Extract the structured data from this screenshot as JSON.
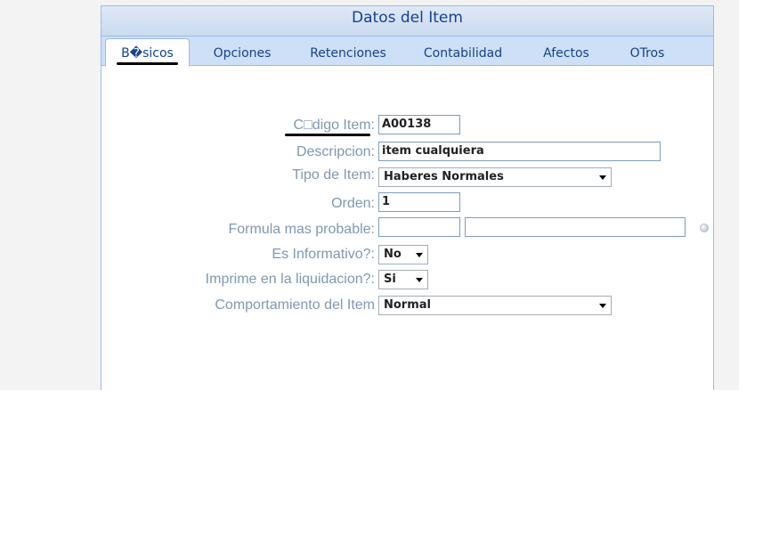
{
  "panel": {
    "title": "Datos del Item"
  },
  "tabs": [
    {
      "label": "B�sicos"
    },
    {
      "label": "Opciones"
    },
    {
      "label": "Retenciones"
    },
    {
      "label": "Contabilidad"
    },
    {
      "label": "Afectos"
    },
    {
      "label": "OTros"
    }
  ],
  "form": {
    "codigo": {
      "label": "C□digo Item:",
      "value": "A00138"
    },
    "descripcion": {
      "label": "Descripcion:",
      "value": "item cualquiera"
    },
    "tipo": {
      "label": "Tipo de Item:",
      "value": "Haberes Normales"
    },
    "orden": {
      "label": "Orden:",
      "value": "1"
    },
    "formula": {
      "label": "Formula mas probable:",
      "value1": "",
      "value2": ""
    },
    "informativo": {
      "label": "Es Informativo?:",
      "value": "No"
    },
    "imprime": {
      "label": "Imprime en la liquidacion?:",
      "value": "Si"
    },
    "comportamiento": {
      "label": "Comportamiento del Item",
      "value": "Normal"
    }
  },
  "colors": {
    "accent": "#15428b",
    "label": "#8098b0",
    "tab_strip": "#cee0f7",
    "border": "#99bbe8"
  },
  "icons": {
    "formula_lookup": "round-button-icon",
    "dropdown": "chevron-down-icon"
  }
}
